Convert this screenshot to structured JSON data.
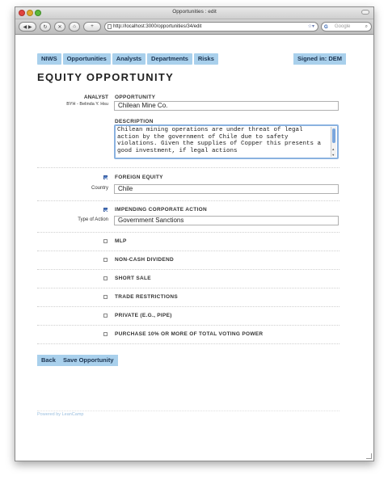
{
  "window": {
    "title": "Opportunities : edit"
  },
  "browser": {
    "url": "http://localhost:3000/opportunities/34/edit",
    "search_placeholder": "Google",
    "search_engine_label": "G"
  },
  "nav": {
    "items": [
      "NIWS",
      "Opportunities",
      "Analysts",
      "Departments",
      "Risks"
    ],
    "signed_in": "Signed in: DEM"
  },
  "page": {
    "title": "EQUITY OPPORTUNITY"
  },
  "analyst": {
    "label": "ANALYST",
    "value": "BYH - Belinda Y. Hsu"
  },
  "opportunity": {
    "label": "OPPORTUNITY",
    "value": "Chilean Mine Co."
  },
  "description": {
    "label": "DESCRIPTION",
    "value": "Chilean mining operations are under threat of legal action by the government of Chile due to safety violations. Given the supplies of Copper this presents a good investment, if legal actions"
  },
  "foreign_equity": {
    "label": "FOREIGN EQUITY",
    "checked": true,
    "country_label": "Country",
    "country_value": "Chile"
  },
  "corporate_action": {
    "label": "IMPENDING CORPORATE ACTION",
    "checked": true,
    "type_label": "Type of Action",
    "type_value": "Government Sanctions"
  },
  "checkboxes": [
    {
      "label": "MLP",
      "checked": false
    },
    {
      "label": "NON-CASH DIVIDEND",
      "checked": false
    },
    {
      "label": "SHORT SALE",
      "checked": false
    },
    {
      "label": "TRADE RESTRICTIONS",
      "checked": false
    },
    {
      "label": "PRIVATE (E.G., PIPE)",
      "checked": false
    },
    {
      "label": "PURCHASE 10% OR MORE OF TOTAL VOTING POWER",
      "checked": false
    }
  ],
  "actions": {
    "back": "Back",
    "save": "Save Opportunity"
  },
  "footer": {
    "powered": "Powered by LeanCamp"
  }
}
